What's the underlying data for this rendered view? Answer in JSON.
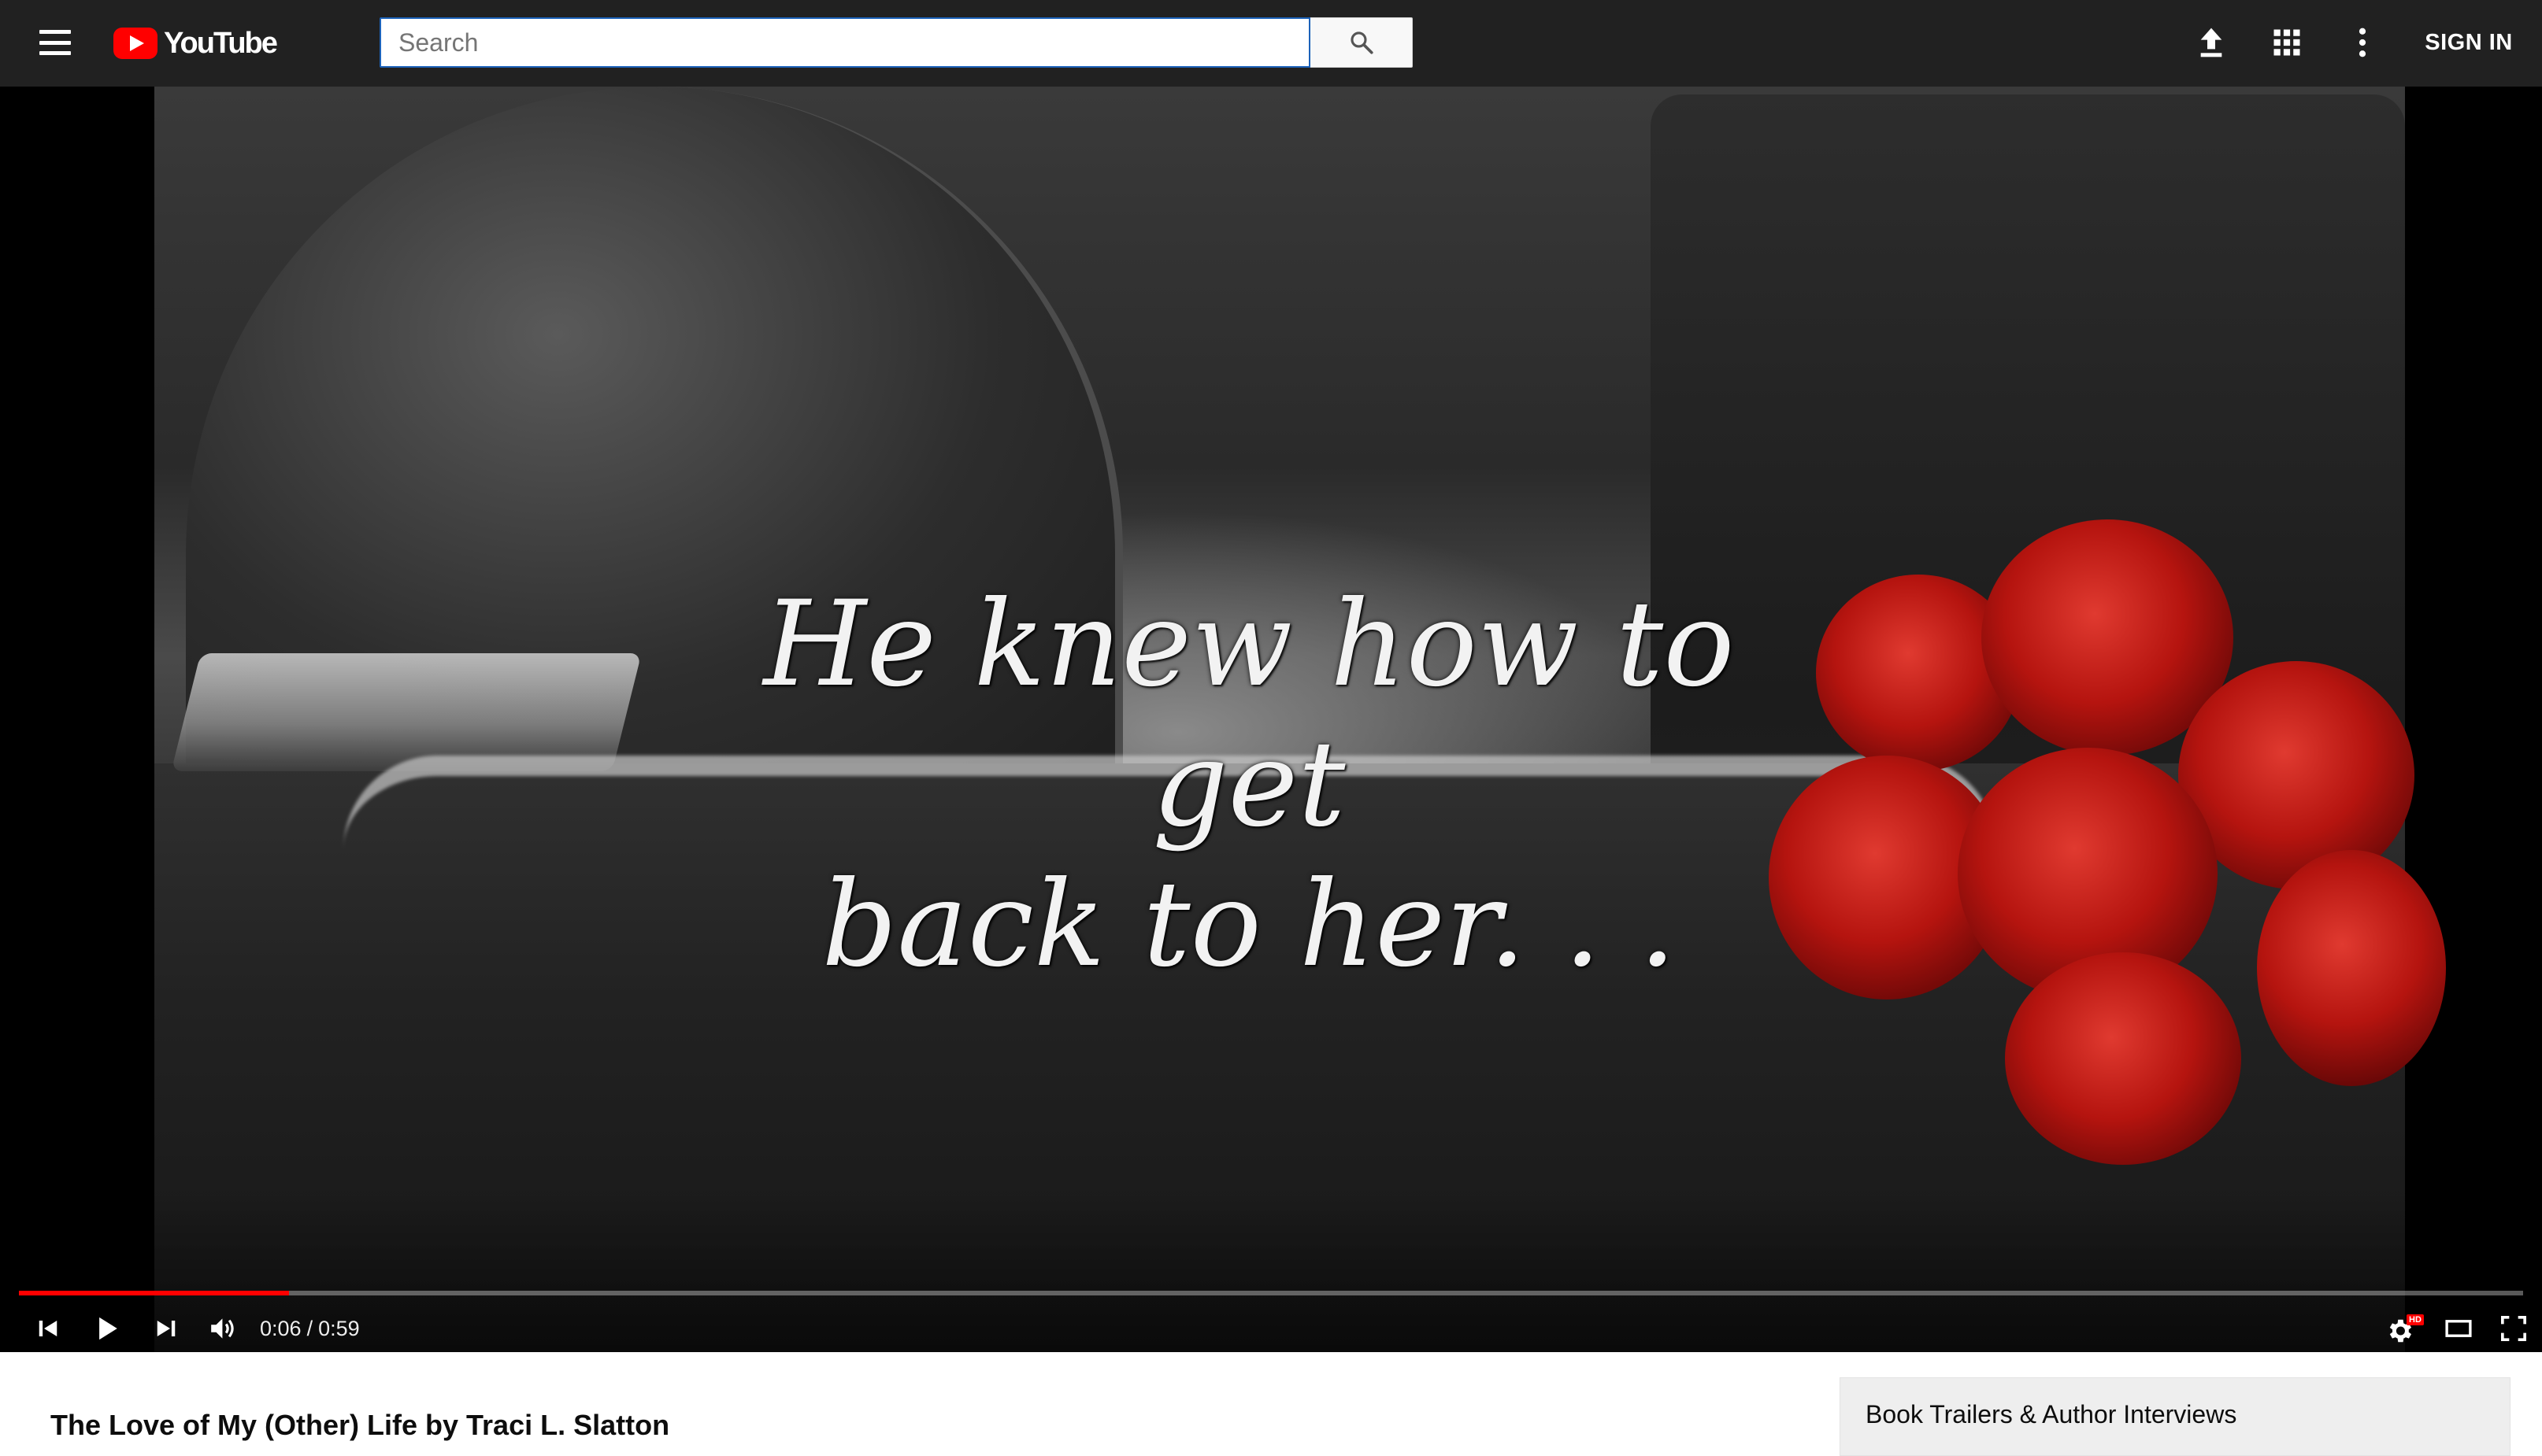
{
  "masthead": {
    "logo_text": "YouTube",
    "search": {
      "placeholder": "Search",
      "value": ""
    },
    "icons": [
      "menu-icon",
      "search-icon",
      "upload-icon",
      "apps-icon",
      "more-vert-icon"
    ],
    "sign_in_label": "SIGN IN",
    "brand_color": "#ff0000",
    "background_color": "#212121"
  },
  "player": {
    "overlay_text_line1": "He knew how to get",
    "overlay_text_line2": "back to her. . .",
    "time_current": "0:06",
    "time_separator": "/",
    "time_total": "0:59",
    "progress_fraction": 0.108,
    "settings_badge": "HD",
    "progress_color": "#ff0000",
    "controls": [
      "previous-icon",
      "play-icon",
      "next-icon",
      "volume-icon",
      "settings-icon",
      "theater-mode-icon",
      "fullscreen-icon"
    ]
  },
  "video": {
    "title": "The Love of My (Other) Life by Traci L. Slatton"
  },
  "playlist": {
    "title": "Book Trailers & Author Interviews"
  }
}
